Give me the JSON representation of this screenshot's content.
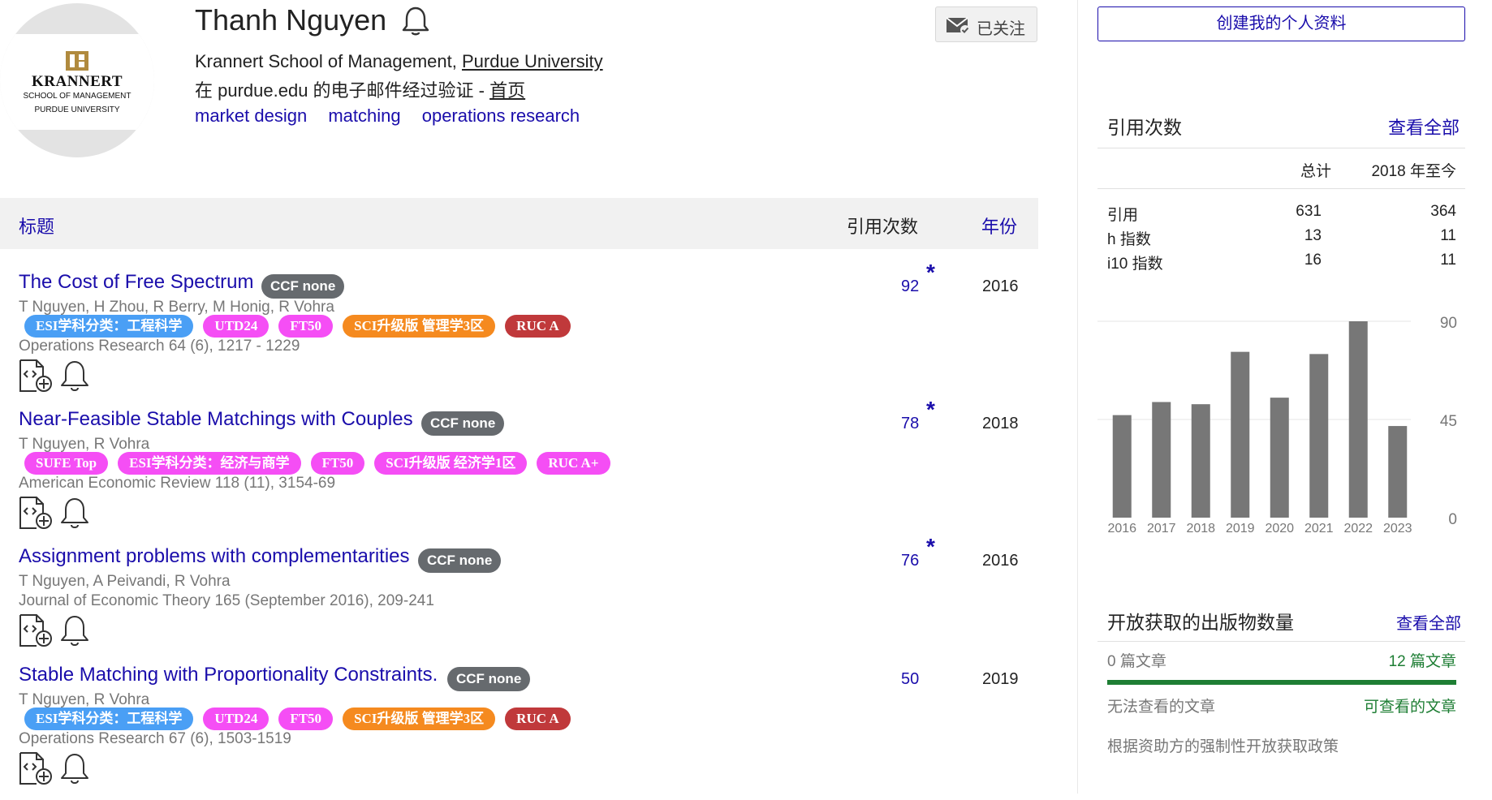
{
  "profile": {
    "name": "Thanh Nguyen",
    "affiliation_prefix": "Krannert School of Management, ",
    "affiliation_university": "Purdue University",
    "verified_text": "在 purdue.edu 的电子邮件经过验证 - ",
    "homepage_label": "首页",
    "interests": [
      "market design",
      "matching",
      "operations research"
    ],
    "follow_label": "已关注",
    "logo": {
      "main": "KRANNERT",
      "sub": "SCHOOL OF MANAGEMENT",
      "sub2": "PURDUE UNIVERSITY"
    }
  },
  "table": {
    "title_header": "标题",
    "cited_header": "引用次数",
    "year_header": "年份"
  },
  "articles": [
    {
      "title": "The Cost of Free Spectrum",
      "ccf": "CCF none",
      "authors": "T Nguyen, H Zhou, R Berry, M Honig, R Vohra",
      "tags": [
        {
          "label": "ESI学科分类：工程科学",
          "color": "#4a9ff5"
        },
        {
          "label": "UTD24",
          "color": "#f54ef5"
        },
        {
          "label": "FT50",
          "color": "#f54ef5"
        },
        {
          "label": "SCI升级版 管理学3区",
          "color": "#f58a1f"
        },
        {
          "label": "RUC A",
          "color": "#c0393b"
        }
      ],
      "venue": "Operations Research 64 (6), 1217 - 1229",
      "cited": "92",
      "star": "*",
      "year": "2016"
    },
    {
      "title": "Near-Feasible Stable Matchings with Couples",
      "ccf": "CCF none",
      "authors": "T Nguyen, R Vohra",
      "tags": [
        {
          "label": "SUFE Top",
          "color": "#f54ef5"
        },
        {
          "label": "ESI学科分类：经济与商学",
          "color": "#f54ef5"
        },
        {
          "label": "FT50",
          "color": "#f54ef5"
        },
        {
          "label": "SCI升级版 经济学1区",
          "color": "#f54ef5"
        },
        {
          "label": "RUC A+",
          "color": "#f54ef5"
        }
      ],
      "venue": "American Economic Review 118 (11), 3154-69",
      "cited": "78",
      "star": "*",
      "year": "2018"
    },
    {
      "title": "Assignment problems with complementarities",
      "ccf": "CCF none",
      "authors": "T Nguyen, A Peivandi, R Vohra",
      "tags": [],
      "venue": "Journal of Economic Theory 165 (September 2016), 209-241",
      "cited": "76",
      "star": "*",
      "year": "2016"
    },
    {
      "title": "Stable Matching with Proportionality Constraints.",
      "ccf": "CCF none",
      "authors": "T Nguyen, R Vohra",
      "tags": [
        {
          "label": "ESI学科分类：工程科学",
          "color": "#4a9ff5"
        },
        {
          "label": "UTD24",
          "color": "#f54ef5"
        },
        {
          "label": "FT50",
          "color": "#f54ef5"
        },
        {
          "label": "SCI升级版 管理学3区",
          "color": "#f58a1f"
        },
        {
          "label": "RUC A",
          "color": "#c0393b"
        }
      ],
      "venue": "Operations Research 67 (6), 1503-1519",
      "cited": "50",
      "star": "",
      "year": "2019"
    }
  ],
  "sidebar": {
    "create_profile": "创建我的个人资料",
    "cited_by": {
      "heading": "引用次数",
      "view_all": "查看全部",
      "col_total": "总计",
      "col_since": "2018 年至今",
      "rows": [
        {
          "label": "引用",
          "total": "631",
          "since": "364"
        },
        {
          "label": "h 指数",
          "total": "13",
          "since": "11"
        },
        {
          "label": "i10 指数",
          "total": "16",
          "since": "11"
        }
      ]
    },
    "open_access": {
      "heading": "开放获取的出版物数量",
      "view_all": "查看全部",
      "unavailable_count": "0 篇文章",
      "available_count": "12 篇文章",
      "unavailable_label": "无法查看的文章",
      "available_label": "可查看的文章",
      "note": "根据资助方的强制性开放获取政策"
    }
  },
  "chart_data": {
    "type": "bar",
    "categories": [
      "2016",
      "2017",
      "2018",
      "2019",
      "2020",
      "2021",
      "2022",
      "2023"
    ],
    "values": [
      47,
      53,
      52,
      76,
      55,
      75,
      90,
      42
    ],
    "ylim": [
      0,
      90
    ],
    "yticks": [
      "90",
      "45",
      "0"
    ],
    "bar_color": "#777777",
    "grid": true
  },
  "colors": {
    "link": "#1a0dab",
    "oa_green": "#1e7e34",
    "ccf_gray": "#666a6e"
  }
}
